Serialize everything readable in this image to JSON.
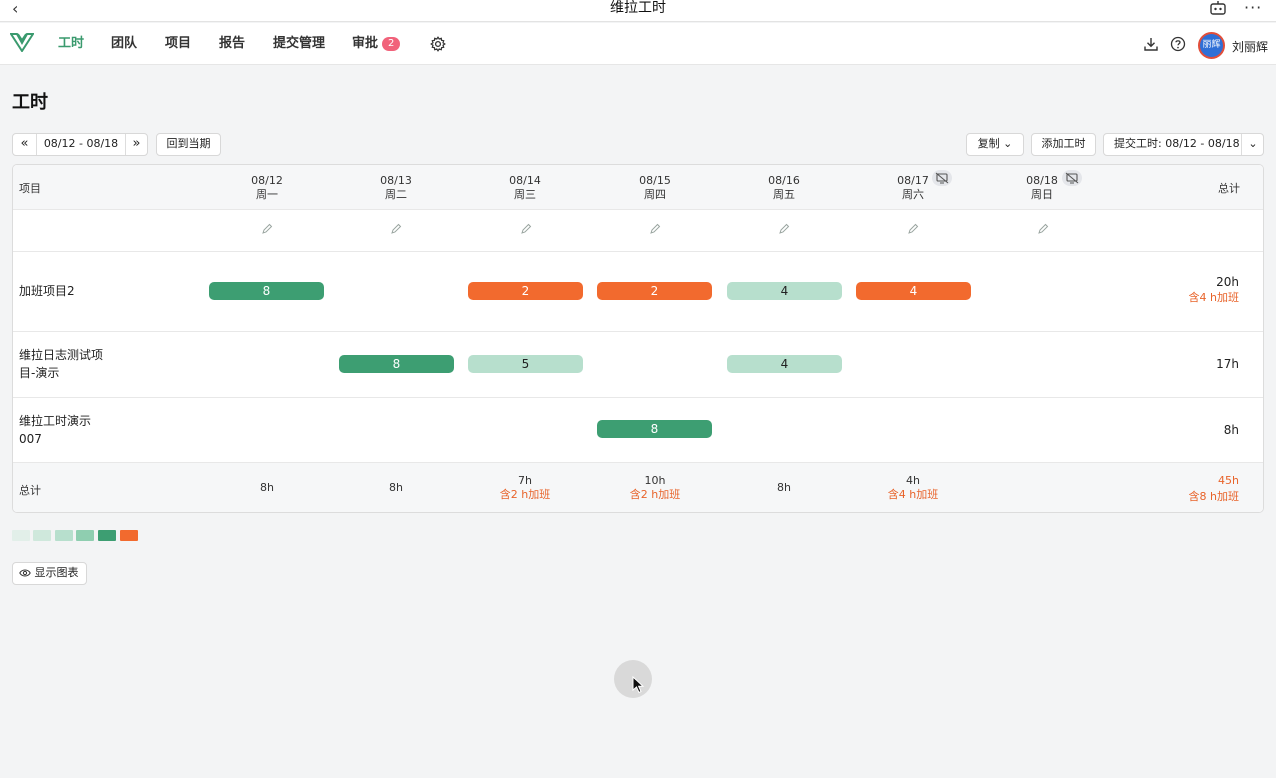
{
  "window": {
    "title": "维拉工时"
  },
  "nav": {
    "items": [
      {
        "label": "工时",
        "active": true
      },
      {
        "label": "团队"
      },
      {
        "label": "项目"
      },
      {
        "label": "报告"
      },
      {
        "label": "提交管理"
      },
      {
        "label": "审批",
        "badge": "2"
      }
    ],
    "avatar_text": "丽辉",
    "user_name": "刘丽辉",
    "accent_color": "#3a9a6e",
    "icons": [
      "settings-icon",
      "download-icon",
      "help-icon"
    ]
  },
  "page": {
    "title": "工时"
  },
  "toolbar": {
    "prev_label": "«",
    "date_range": "08/12 - 08/18",
    "next_label": "»",
    "current_period": "回到当期",
    "copy": "复制",
    "add_hours": "添加工时",
    "submit": "提交工时: 08/12 - 08/18"
  },
  "table": {
    "project_header": "项目",
    "total_header": "总计",
    "days": [
      {
        "date": "08/12",
        "weekday": "周一"
      },
      {
        "date": "08/13",
        "weekday": "周二"
      },
      {
        "date": "08/14",
        "weekday": "周三"
      },
      {
        "date": "08/15",
        "weekday": "周四"
      },
      {
        "date": "08/16",
        "weekday": "周五"
      },
      {
        "date": "08/17",
        "weekday": "周六",
        "non_working": true
      },
      {
        "date": "08/18",
        "weekday": "周日",
        "non_working": true
      }
    ],
    "rows": [
      {
        "name": "加班项目2",
        "cells": [
          "8",
          "",
          "2",
          "2",
          "4",
          "4",
          ""
        ],
        "total": "20h",
        "overtime": "含4 h加班"
      },
      {
        "name": "维拉日志测试项目-演示",
        "name_line1": "维拉日志测试项",
        "name_line2": "目-演示",
        "cells": [
          "",
          "8",
          "5",
          "",
          "4",
          "",
          ""
        ],
        "total": "17h"
      },
      {
        "name": "维拉工时演示007",
        "name_line1": "维拉工时演示",
        "name_line2": "007",
        "cells": [
          "",
          "",
          "",
          "8",
          "",
          "",
          ""
        ],
        "total": "8h"
      }
    ],
    "footer": {
      "label": "总计",
      "days": [
        {
          "hours": "8h"
        },
        {
          "hours": "8h"
        },
        {
          "hours": "7h",
          "overtime": "含2 h加班"
        },
        {
          "hours": "10h",
          "overtime": "含2 h加班"
        },
        {
          "hours": "8h"
        },
        {
          "hours": "4h",
          "overtime": "含4 h加班"
        },
        {
          "hours": ""
        }
      ],
      "total": "45h",
      "total_overtime": "含8 h加班"
    }
  },
  "legend_colors": [
    "#e2efe9",
    "#cfe8dc",
    "#b7dfcd",
    "#8fceb0",
    "#3d9e72",
    "#f26a2e"
  ],
  "show_chart": "显示图表"
}
